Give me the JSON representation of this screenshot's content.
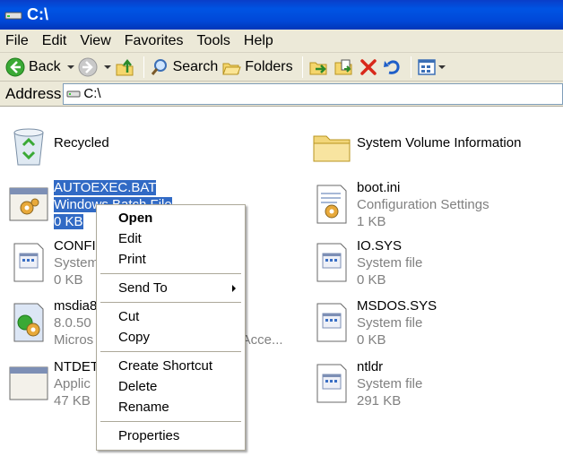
{
  "window": {
    "title": "C:\\"
  },
  "menu": [
    "File",
    "Edit",
    "View",
    "Favorites",
    "Tools",
    "Help"
  ],
  "toolbar": {
    "back_label": "Back",
    "search_label": "Search",
    "folders_label": "Folders"
  },
  "address": {
    "label": "Address",
    "value": "C:\\"
  },
  "files": [
    {
      "name": "Recycled",
      "type": "",
      "size": ""
    },
    {
      "name": "System Volume Information",
      "type": "",
      "size": ""
    },
    {
      "name": "AUTOEXEC.BAT",
      "type": "Windows Batch File",
      "size": "0 KB"
    },
    {
      "name": "boot.ini",
      "type": "Configuration Settings",
      "size": "1 KB"
    },
    {
      "name": "CONFI",
      "type": "System",
      "size": "0 KB"
    },
    {
      "name": "IO.SYS",
      "type": "System file",
      "size": "0 KB"
    },
    {
      "name": "msdia8",
      "type": "8.0.50",
      "size": "Micros",
      "extra": "n Acce..."
    },
    {
      "name": "MSDOS.SYS",
      "type": "System file",
      "size": "0 KB"
    },
    {
      "name": "NTDET",
      "type": "Applic",
      "size": "47 KB"
    },
    {
      "name": "ntldr",
      "type": "System file",
      "size": "291 KB"
    }
  ],
  "context_menu": {
    "open": "Open",
    "edit": "Edit",
    "print": "Print",
    "send_to": "Send To",
    "cut": "Cut",
    "copy": "Copy",
    "create_shortcut": "Create Shortcut",
    "delete": "Delete",
    "rename": "Rename",
    "properties": "Properties"
  },
  "colors": {
    "title_bar": "#0054e3",
    "selection": "#316ac5",
    "chrome": "#ece9d8"
  }
}
